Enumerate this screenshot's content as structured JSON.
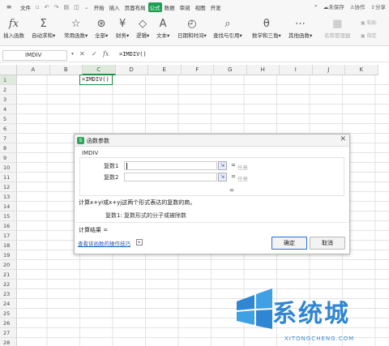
{
  "menubar": {
    "file": "文件",
    "items": [
      "开始",
      "插入",
      "页面布局",
      "公式",
      "数据",
      "审阅",
      "视图",
      "开发"
    ],
    "active_index": 3,
    "right": [
      "未保存",
      "协作",
      "分享"
    ]
  },
  "ribbon": {
    "buttons": [
      "插入函数",
      "自动求和",
      "常用函数",
      "全部",
      "财务",
      "逻辑",
      "文本",
      "日期和时间",
      "查找与引用",
      "数学和三角",
      "其他函数",
      "名称管理器"
    ],
    "mini": [
      "粘贴",
      "指定"
    ]
  },
  "formula_bar": {
    "name_box": "IMDIV",
    "formula": "=IMDIV()"
  },
  "sheet": {
    "columns": [
      "A",
      "B",
      "C",
      "D",
      "E",
      "F",
      "G",
      "H",
      "I",
      "J",
      "K"
    ],
    "selected_column": "C",
    "rows": [
      "1",
      "2",
      "3",
      "4",
      "5",
      "6",
      "7",
      "8",
      "9",
      "10",
      "11",
      "12",
      "13",
      "14",
      "15",
      "16",
      "17",
      "18",
      "19",
      "20",
      "21",
      "22",
      "23",
      "24",
      "25",
      "26",
      "27",
      "28"
    ],
    "selected_row": "1",
    "active_cell_value": "=IMDIV()"
  },
  "dialog": {
    "title": "函数参数",
    "function_name": "IMDIV",
    "args": [
      {
        "label": "复数1",
        "eq": "=",
        "hint": "任意"
      },
      {
        "label": "复数2",
        "eq": "=",
        "hint": "任意"
      }
    ],
    "result_eq": "=",
    "description": "计算x+yi或x+yj这两个形式表达的复数的商。",
    "arg_description": "复数1:  复数形式的分子或被除数",
    "calc_result": "计算结果 =",
    "help_link": "查看该函数的操作技巧",
    "ok": "确定",
    "cancel": "取消"
  },
  "watermark": {
    "text": "系统城",
    "sub": "XITONGCHENG.COM"
  }
}
